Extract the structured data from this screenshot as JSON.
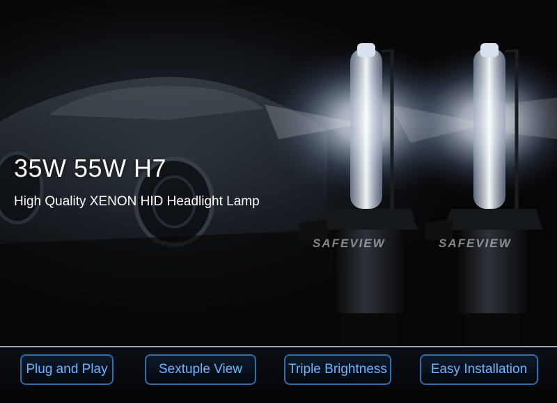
{
  "headline": "35W 55W H7",
  "subheadline": "High Quality XENON HID Headlight Lamp",
  "brand_watermarks": [
    "SAFEVIEW",
    "SAFEVIEW"
  ],
  "features": [
    {
      "label": "Plug and Play"
    },
    {
      "label": "Sextuple View"
    },
    {
      "label": "Triple Brightness"
    },
    {
      "label": "Easy Installation"
    }
  ],
  "colors": {
    "background": "#050607",
    "feature_text": "#6fb4ff",
    "feature_border": "#2f6fb0",
    "headline_text": "#ffffff"
  }
}
